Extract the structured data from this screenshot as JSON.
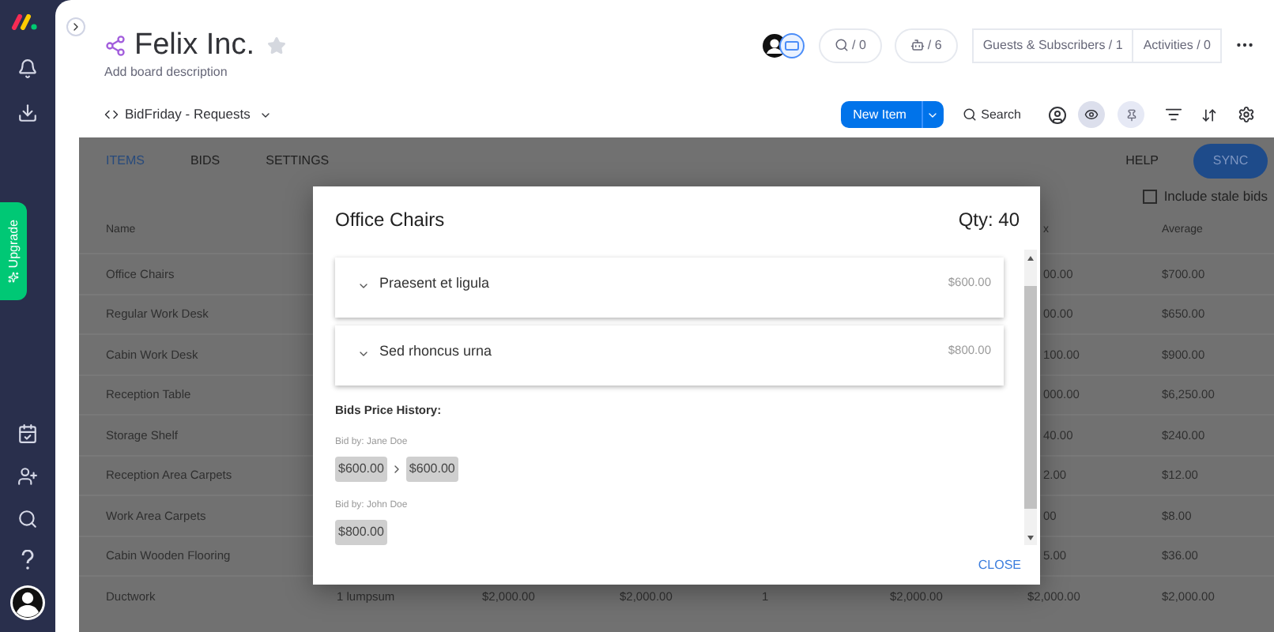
{
  "sidebar": {
    "upgrade": "Upgrade"
  },
  "board": {
    "title": "Felix Inc.",
    "starred": false,
    "description": "Add board description",
    "view": "BidFriday - Requests",
    "counters": [
      {
        "kind": "search",
        "label": "/ 0"
      },
      {
        "kind": "robot",
        "label": "/ 6"
      }
    ],
    "guests": "Guests & Subscribers / 1",
    "activities": "Activities / 0",
    "new_item": "New Item",
    "search": "Search"
  },
  "app": {
    "tabs": [
      {
        "label": "ITEMS",
        "selected": true
      },
      {
        "label": "BIDS",
        "selected": false
      },
      {
        "label": "SETTINGS",
        "selected": false
      }
    ],
    "help": "HELP",
    "sync": "SYNC",
    "stale_bids": {
      "label": "Include stale bids",
      "checked": false
    }
  },
  "table": {
    "header": {
      "name": "Name",
      "column_7": "x",
      "average": "Average"
    },
    "rows": [
      {
        "name": "Office Chairs",
        "column_7": "00.00",
        "average": "$700.00"
      },
      {
        "name": "Regular Work Desk",
        "column_7": "00.00",
        "average": "$650.00"
      },
      {
        "name": "Cabin Work Desk",
        "column_7": "100.00",
        "average": "$900.00"
      },
      {
        "name": "Reception Table",
        "column_7": "000.00",
        "average": "$6,250.00"
      },
      {
        "name": "Storage Shelf",
        "column_7": "40.00",
        "average": "$240.00"
      },
      {
        "name": "Reception Area Carpets",
        "column_7": "2.00",
        "average": "$12.00"
      },
      {
        "name": "Work Area Carpets",
        "column_7": "00",
        "average": "$8.00"
      },
      {
        "name": "Cabin Wooden Flooring",
        "column_7": "5.00",
        "average": "$36.00"
      },
      {
        "name": "Ductwork",
        "column_2": "1 lumpsum",
        "column_3": "$2,000.00",
        "column_4": "$2,000.00",
        "column_5": "1",
        "column_6": "$2,000.00",
        "column_7": "$2,000.00",
        "average": "$2,000.00"
      }
    ]
  },
  "dialog": {
    "title": "Office Chairs",
    "qty": "Qty: 40",
    "bids": [
      {
        "title": "Praesent et ligula",
        "price": "$600.00",
        "expanded": false
      },
      {
        "title": "Sed rhoncus urna",
        "price": "$800.00",
        "expanded": false
      }
    ],
    "history_title": "Bids Price History:",
    "history": [
      {
        "bidder": "Bid by: Jane Doe",
        "prices": [
          "$600.00",
          "$600.00"
        ]
      },
      {
        "bidder": "Bid by: John Doe",
        "prices": [
          "$800.00"
        ]
      }
    ],
    "close": "CLOSE"
  }
}
